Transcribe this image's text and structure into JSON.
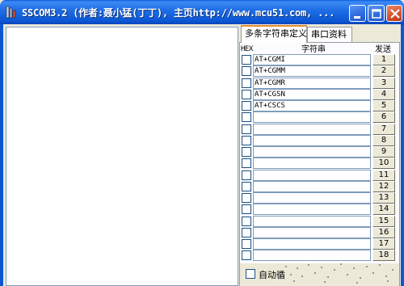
{
  "window": {
    "title": "SSCOM3.2 (作者:聂小猛(丁丁), 主页http://www.mcu51.com, ..."
  },
  "tabs": [
    {
      "label": "多条字符串定义",
      "active": true
    },
    {
      "label": "串口资料",
      "active": false
    }
  ],
  "table": {
    "headers": {
      "hex": "HEX",
      "string": "字符串",
      "send": "发送"
    },
    "rows": [
      {
        "hex": false,
        "value": "AT+CGMI",
        "send": "1"
      },
      {
        "hex": false,
        "value": "AT+CGMM",
        "send": "2"
      },
      {
        "hex": false,
        "value": "AT+CGMR",
        "send": "3"
      },
      {
        "hex": false,
        "value": "AT+CGSN",
        "send": "4"
      },
      {
        "hex": false,
        "value": "AT+CSCS",
        "send": "5"
      },
      {
        "hex": false,
        "value": "",
        "send": "6"
      },
      {
        "hex": false,
        "value": "",
        "send": "7"
      },
      {
        "hex": false,
        "value": "",
        "send": "8"
      },
      {
        "hex": false,
        "value": "",
        "send": "9"
      },
      {
        "hex": false,
        "value": "",
        "send": "10"
      },
      {
        "hex": false,
        "value": "",
        "send": "11"
      },
      {
        "hex": false,
        "value": "",
        "send": "12"
      },
      {
        "hex": false,
        "value": "",
        "send": "13"
      },
      {
        "hex": false,
        "value": "",
        "send": "14"
      },
      {
        "hex": false,
        "value": "",
        "send": "15"
      },
      {
        "hex": false,
        "value": "",
        "send": "16"
      },
      {
        "hex": false,
        "value": "",
        "send": "17"
      },
      {
        "hex": false,
        "value": "",
        "send": "18"
      }
    ]
  },
  "auto_loop": {
    "label": "自动循",
    "checked": false
  },
  "icons": {
    "app": "app-icon",
    "minimize": "minimize-icon",
    "maximize": "maximize-icon",
    "close": "close-icon"
  },
  "colors": {
    "titlebar": "#0b56d3",
    "tab_highlight": "#e68b2c",
    "face": "#ece9d8"
  }
}
